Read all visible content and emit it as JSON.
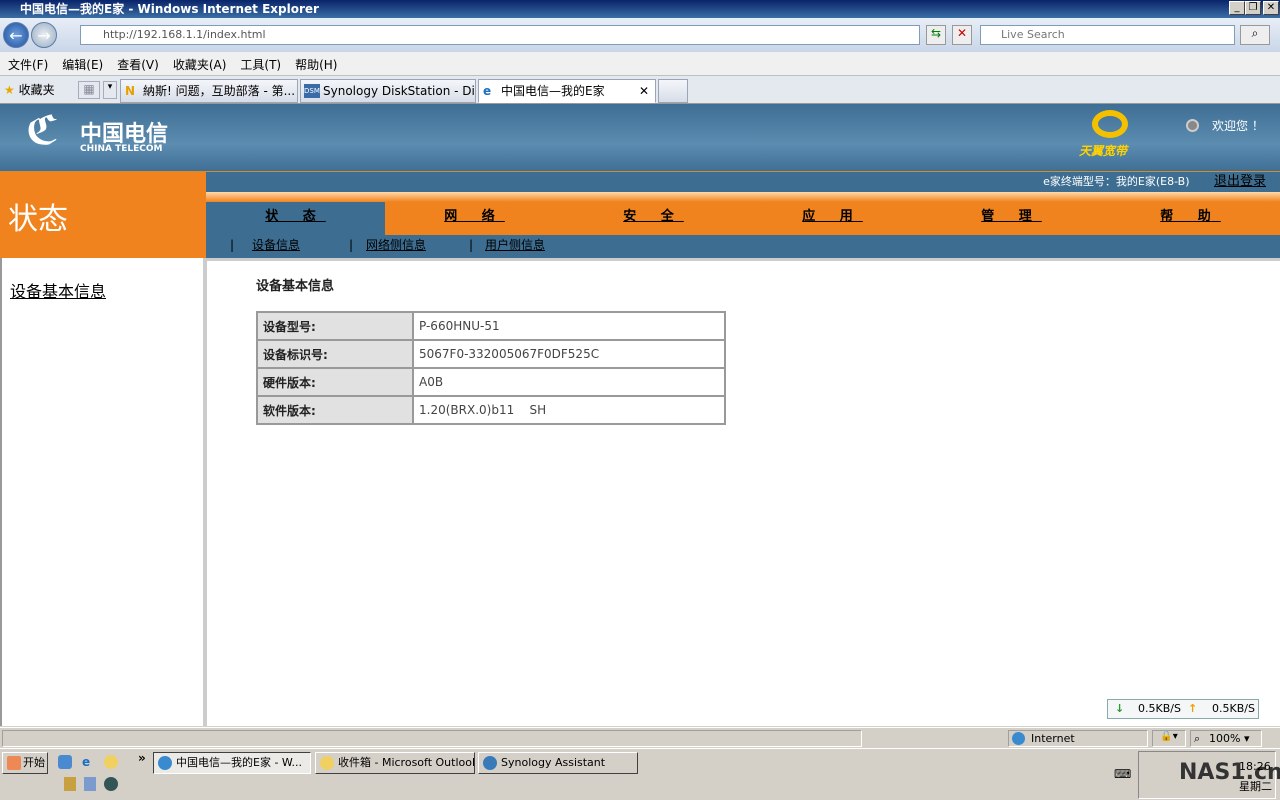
{
  "window": {
    "title": "中国电信—我的E家 - Windows Internet Explorer",
    "min": "_",
    "max": "❐",
    "close": "✕"
  },
  "browser": {
    "back": "←",
    "forward": "→",
    "url": "http://192.168.1.1/index.html",
    "search_placeholder": "Live Search",
    "menu": [
      "文件(F)",
      "编辑(E)",
      "查看(V)",
      "收藏夹(A)",
      "工具(T)",
      "帮助(H)"
    ],
    "favorites": "收藏夹",
    "tabs": [
      "納斯! 问题，互助部落 - 第...",
      "Synology DiskStation - DiskS...",
      "中国电信—我的E家"
    ],
    "tab_close": "✕"
  },
  "page": {
    "logo_cn": "中国电信",
    "logo_en": "CHINA TELECOM",
    "brand": "天翼宽带",
    "welcome": "欢迎您 ！",
    "section": "状态",
    "terminal_info": "e家终端型号：我的E家(E8-B)",
    "logout": "退出登录",
    "nav": [
      "状 态",
      "网 络",
      "安 全",
      "应 用",
      "管 理",
      "帮 助"
    ],
    "subnav": [
      "设备信息",
      "网络侧信息",
      "用户侧信息"
    ],
    "sidebar_link": "设备基本信息",
    "heading": "设备基本信息",
    "rows": [
      {
        "k": "设备型号:",
        "v": "P-660HNU-51"
      },
      {
        "k": "设备标识号:",
        "v": "5067F0-332005067F0DF525C"
      },
      {
        "k": "硬件版本:",
        "v": "A0B"
      },
      {
        "k": "软件版本:",
        "v": "1.20(BRX.0)b11    SH"
      }
    ],
    "down_speed": "0.5KB/S",
    "up_speed": "0.5KB/S"
  },
  "status": {
    "zone": "Internet",
    "zoom": "100%"
  },
  "taskbar": {
    "start": "开始",
    "items": [
      "中国电信—我的E家 - W...",
      "收件箱 - Microsoft Outlook",
      "Synology Assistant"
    ],
    "time": "18:26",
    "day": "星期二",
    "watermark": "NAS1.cn"
  },
  "colors": {
    "orange": "#f0831e",
    "blue": "#3d6e91"
  }
}
